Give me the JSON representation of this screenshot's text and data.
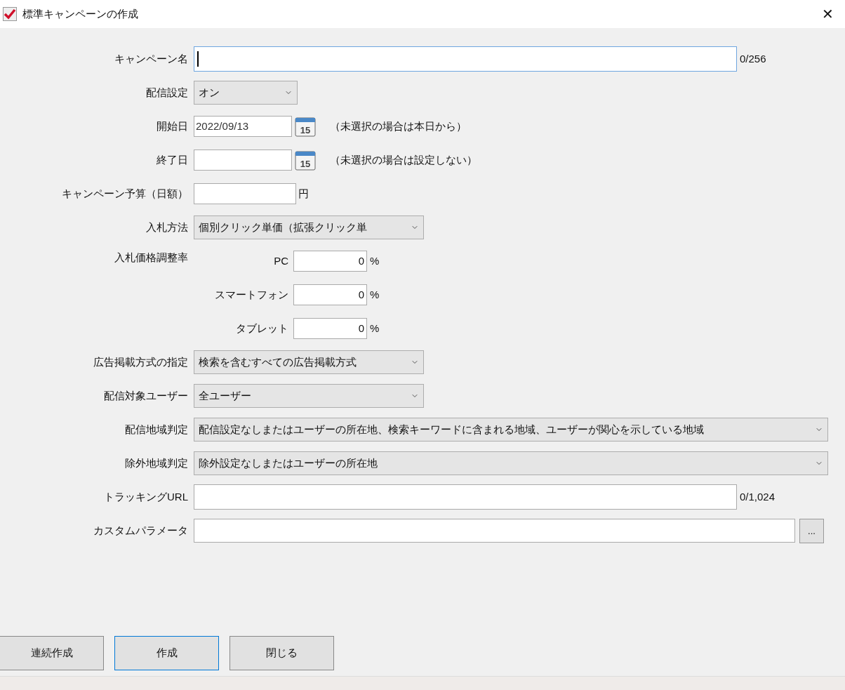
{
  "window": {
    "title": "標準キャンペーンの作成",
    "close": "✕"
  },
  "fields": [
    {
      "kind": "text",
      "label": "キャンペーン名",
      "counter": "0/256",
      "focused": true
    },
    {
      "kind": "select",
      "label": "配信設定",
      "value": "オン"
    },
    {
      "kind": "date",
      "label": "開始日",
      "value": "2022/09/13",
      "calendar_day": "15",
      "note": "（未選択の場合は本日から）"
    },
    {
      "kind": "date",
      "label": "終了日",
      "calendar_day": "15",
      "note": "（未選択の場合は設定しない）"
    },
    {
      "kind": "amount",
      "label": "キャンペーン予算（日額）",
      "unit": "円"
    },
    {
      "kind": "select",
      "label": "入札方法",
      "value": "個別クリック単価（拡張クリック単"
    },
    {
      "kind": "adjust",
      "label": "入札価格調整率",
      "devices": [
        {
          "name": "PC",
          "value": "0",
          "unit": "%"
        },
        {
          "name": "スマートフォン",
          "value": "0",
          "unit": "%"
        },
        {
          "name": "タブレット",
          "value": "0",
          "unit": "%"
        }
      ]
    },
    {
      "kind": "select",
      "label": "広告掲載方式の指定",
      "value": "検索を含むすべての広告掲載方式"
    },
    {
      "kind": "select",
      "label": "配信対象ユーザー",
      "value": "全ユーザー"
    },
    {
      "kind": "select",
      "label": "配信地域判定",
      "value": "配信設定なしまたはユーザーの所在地、検索キーワードに含まれる地域、ユーザーが関心を示している地域"
    },
    {
      "kind": "select",
      "label": "除外地域判定",
      "value": "除外設定なしまたはユーザーの所在地"
    },
    {
      "kind": "text",
      "label": "トラッキングURL",
      "counter": "0/1,024",
      "focused": false
    },
    {
      "kind": "param",
      "label": "カスタムパラメータ",
      "button": "..."
    }
  ],
  "buttons": [
    {
      "label": "連続作成",
      "focused": false
    },
    {
      "label": "作成",
      "focused": true
    },
    {
      "label": "閉じる",
      "focused": false
    }
  ]
}
